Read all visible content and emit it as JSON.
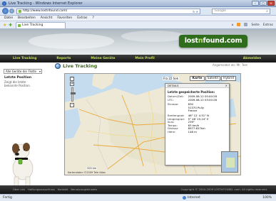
{
  "browser": {
    "title": "Live Tracking - Windows Internet Explorer",
    "url": "http://www.lostnfound.com/",
    "search_placeholder": "Google",
    "menu": [
      "Datei",
      "Bearbeiten",
      "Ansicht",
      "Favoriten",
      "Extras",
      "?"
    ],
    "tab_label": "Live Tracking",
    "cmd_seite": "Seite",
    "cmd_extras": "Extras",
    "status_done": "Fertig",
    "status_zone": "Internet",
    "status_zoom": "100%"
  },
  "site": {
    "logo_part1": "lost",
    "logo_dot": "n",
    "logo_part2": "found.com",
    "nav": [
      "Live Tracking",
      "Reports",
      "Meine Geräte",
      "Mein Profil",
      "Abmelden"
    ],
    "login_note": "Angemeldet als: Mr. Test",
    "device_select": "Alle Geräte der Flotte",
    "sidebar_heading": "Letzte Position",
    "sidebar_text": "Zeigt die letzte bekannte Position."
  },
  "tracking": {
    "title": "Live Tracking",
    "map_types": [
      "Karte",
      "Satellit",
      "Hybrid"
    ],
    "scale_text": "Fra 22 Sek",
    "scalebar": "200 km",
    "attrib": "Kartendaten ©2009 Tele Atlas",
    "popup_header": "DETAILS",
    "popup_title": "Letzte gespeicherte Position:",
    "popup_rows": [
      {
        "k": "Datum/Zeit:",
        "v": "2009-08-12 05:00:28"
      },
      {
        "k": "UTC:",
        "v": "2009-08-12 03:00:28"
      },
      {
        "k": "Strasse:",
        "v": "830"
      },
      {
        "k": "",
        "v": "51370 Pully"
      },
      {
        "k": "",
        "v": "France"
      },
      {
        "k": "Breitengrad:",
        "v": "46° 12' 4.51\" N"
      },
      {
        "k": "Längengrad:",
        "v": "5° 46' 25.24\" E"
      },
      {
        "k": "Kurs:",
        "v": "239°"
      },
      {
        "k": "Tempo:",
        "v": "63 km/h"
      },
      {
        "k": "Distanz:",
        "v": "8977.627km"
      },
      {
        "k": "Höhe:",
        "v": "148 m"
      }
    ]
  },
  "footer": {
    "links": [
      "Über uns",
      "Haftungsausschluss",
      "Kontakt",
      "Benutzungshinweis"
    ],
    "copyright": "Copyright © 2004-2009 LOSTnFOUND. com. All rights reserved."
  }
}
